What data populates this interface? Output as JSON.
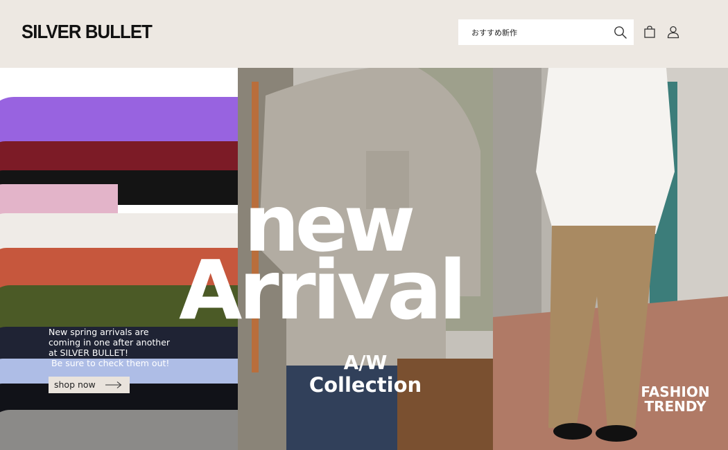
{
  "header": {
    "logo": "SILVER BULLET",
    "search": {
      "value": "おすすめ新作",
      "placeholder": "おすすめ新作"
    }
  },
  "hero": {
    "headline_line1": "new",
    "headline_line2": "Arrival",
    "tagline": "New spring arrivals are\ncoming in one after another\nat SILVER BULLET!\n Be sure to check them out!",
    "shop_button_label": "shop now",
    "collection_line1": "A/W",
    "collection_line2": "Collection",
    "fashion_label": "FASHION\nTRENDY"
  },
  "colors": {
    "header_bg": "#ede8e2",
    "search_bg": "#ffffff",
    "button_bg": "#e9e3dc",
    "text_white": "#ffffff",
    "logo": "#111111"
  },
  "icons": [
    "search-icon",
    "shopping-bag-icon",
    "user-icon",
    "arrow-right-icon"
  ]
}
